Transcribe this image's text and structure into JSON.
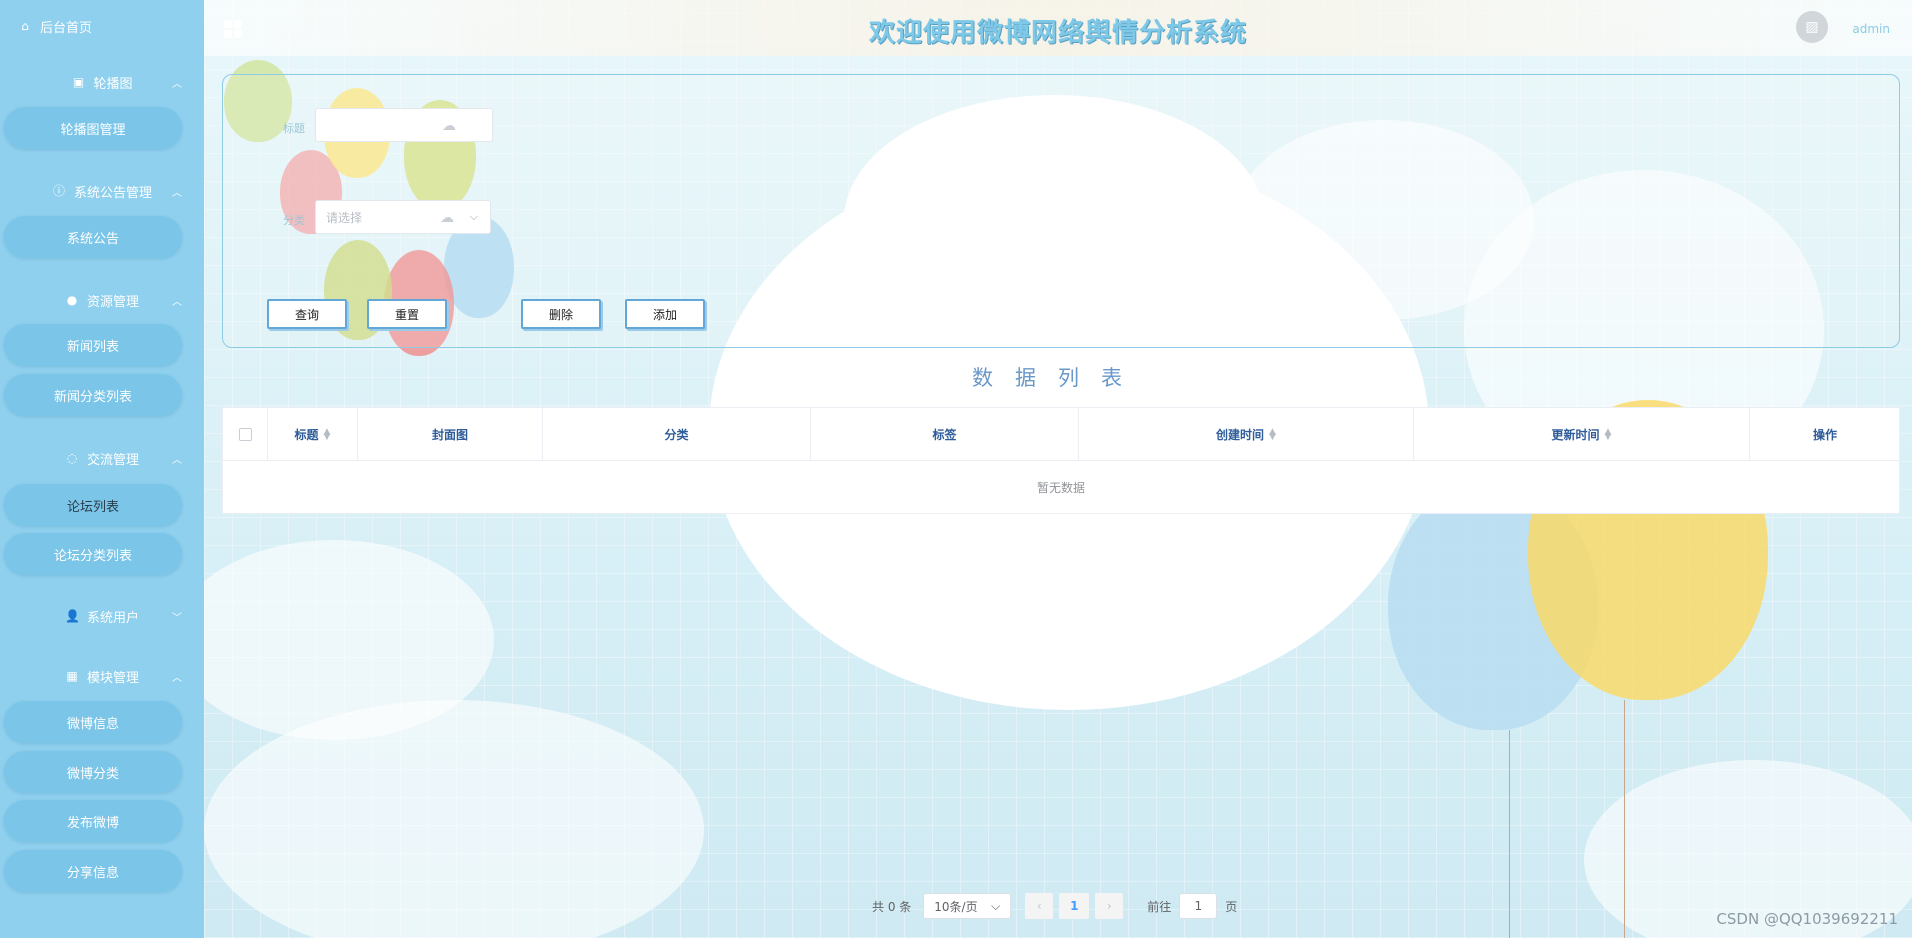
{
  "header": {
    "title": "欢迎使用微博网络舆情分析系统",
    "user": "admin"
  },
  "sidebar": {
    "home": "后台首页",
    "groups": [
      {
        "label": "轮播图",
        "icon": "image-icon",
        "items": [
          "轮播图管理"
        ]
      },
      {
        "label": "系统公告管理",
        "icon": "info-icon",
        "items": [
          "系统公告"
        ]
      },
      {
        "label": "资源管理",
        "icon": "location-icon",
        "items": [
          "新闻列表",
          "新闻分类列表"
        ]
      },
      {
        "label": "交流管理",
        "icon": "chat-icon",
        "items": [
          "论坛列表",
          "论坛分类列表"
        ]
      },
      {
        "label": "系统用户",
        "icon": "user-icon",
        "items": []
      },
      {
        "label": "模块管理",
        "icon": "grid-icon",
        "items": [
          "微博信息",
          "微博分类",
          "发布微博",
          "分享信息"
        ]
      }
    ]
  },
  "search": {
    "title_label": "标题",
    "category_label": "分类",
    "category_placeholder": "请选择",
    "buttons": {
      "query": "查询",
      "reset": "重置",
      "delete": "删除",
      "add": "添加"
    }
  },
  "list_title": "数据列表",
  "table": {
    "columns": [
      "标题",
      "封面图",
      "分类",
      "标签",
      "创建时间",
      "更新时间",
      "操作"
    ],
    "empty_text": "暂无数据"
  },
  "pagination": {
    "total": "共 0 条",
    "page_size": "10条/页",
    "current_page": "1",
    "goto_prefix": "前往",
    "goto_value": "1",
    "goto_suffix": "页"
  },
  "watermark": "CSDN @QQ1039692211"
}
